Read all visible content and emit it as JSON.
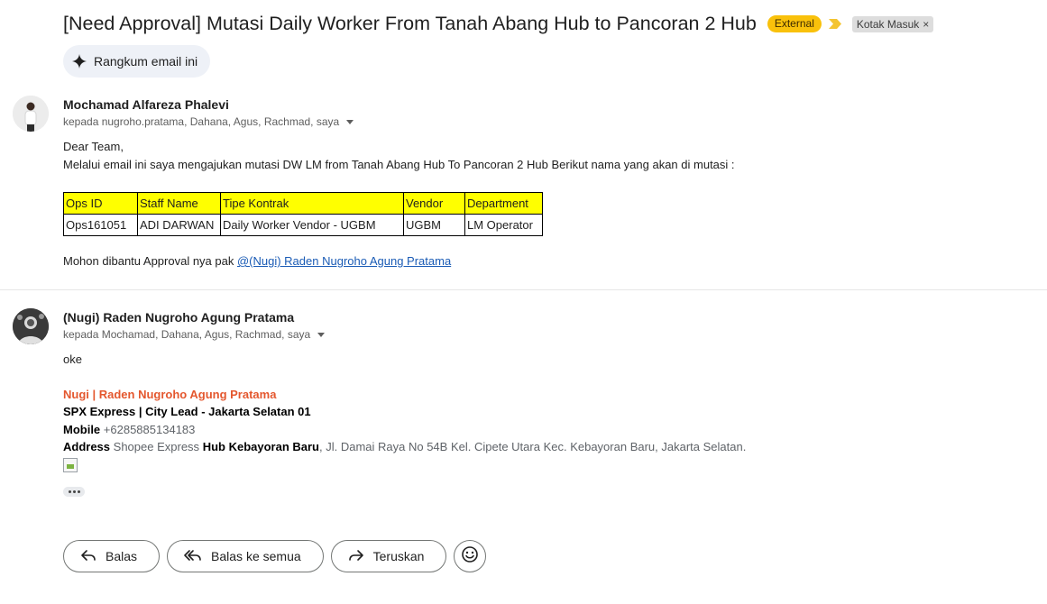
{
  "email": {
    "subject": "[Need Approval] Mutasi Daily Worker From Tanah Abang Hub to Pancoran 2 Hub",
    "external_badge": "External",
    "label": "Kotak Masuk",
    "label_remove": "×",
    "summarize_label": "Rangkum email ini"
  },
  "messages": [
    {
      "sender": "Mochamad Alfareza Phalevi",
      "recipients": "kepada nugroho.pratama, Dahana, Agus, Rachmad, saya",
      "greeting": "Dear Team,",
      "intro": "Melalui email ini saya mengajukan mutasi DW LM from Tanah Abang Hub To Pancoran 2 Hub Berikut nama yang akan di mutasi :",
      "table": {
        "headers": [
          "Ops ID",
          "Staff Name",
          "Tipe Kontrak",
          "Vendor",
          "Department"
        ],
        "rows": [
          [
            "Ops161051",
            "ADI DARWAN",
            "Daily Worker Vendor - UGBM",
            "UGBM",
            "LM Operator"
          ]
        ]
      },
      "closing_text": "Mohon dibantu Approval nya pak ",
      "mention": "@(Nugi) Raden Nugroho Agung Pratama"
    },
    {
      "sender": "(Nugi) Raden Nugroho Agung Pratama",
      "recipients": "kepada Mochamad, Dahana, Agus, Rachmad, saya",
      "body": "oke",
      "signature": {
        "name": "Nugi | Raden Nugroho Agung Pratama",
        "title": "SPX Express | City Lead - Jakarta Selatan 01",
        "mobile_label": "Mobile",
        "mobile_value": "+6285885134183",
        "address_label": "Address",
        "address_part1": "Shopee Express",
        "address_part2": "Hub Kebayoran Baru",
        "address_part3": ", Jl. Damai Raya No 54B",
        "address_part4": "Kel. Cipete Utara Kec. Kebayoran Baru, Jakarta Selatan."
      }
    }
  ],
  "actions": {
    "reply": "Balas",
    "reply_all": "Balas ke semua",
    "forward": "Teruskan"
  },
  "icons": {
    "summarize": "sparkle-icon",
    "importance": "importance-marker-icon",
    "reply": "reply-icon",
    "reply_all": "reply-all-icon",
    "forward": "forward-icon",
    "emoji": "emoji-icon"
  },
  "colors": {
    "external_badge": "#f9c10b",
    "table_header": "#ffff00",
    "signature_name": "#e4572e",
    "link": "#1a5bb5"
  }
}
